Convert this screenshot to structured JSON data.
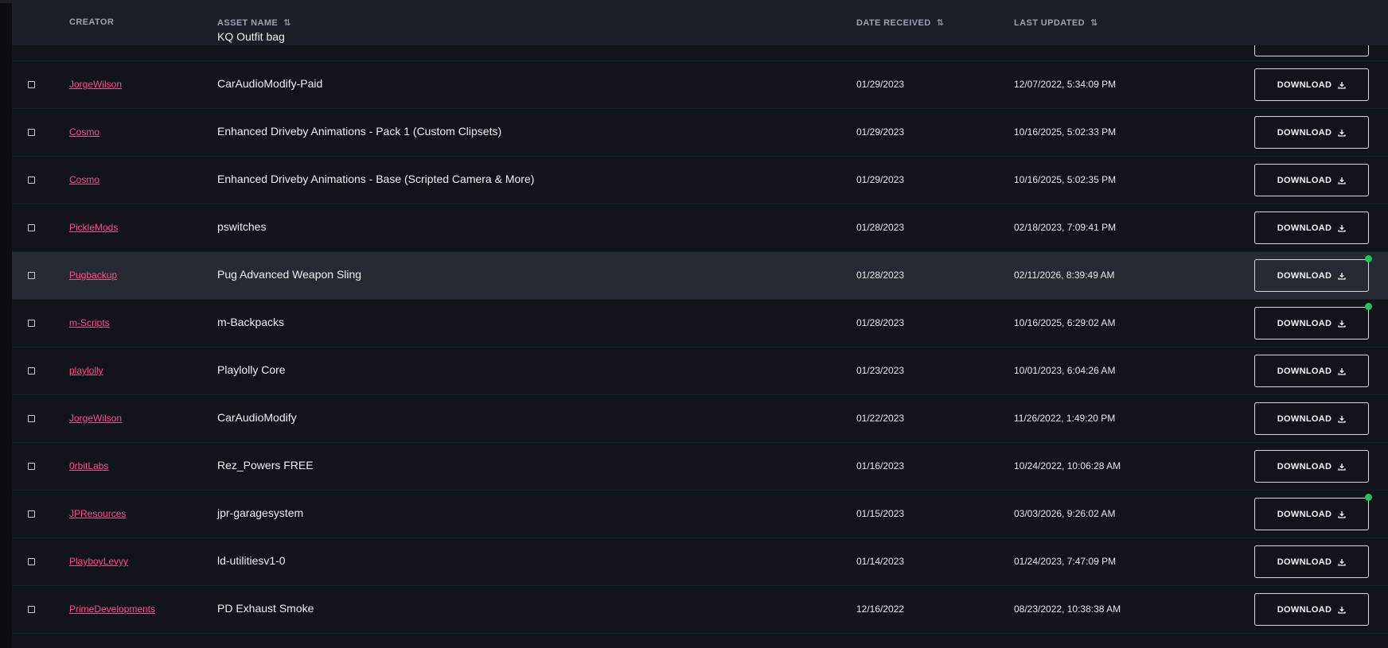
{
  "header": {
    "creator": "CREATOR",
    "asset_name": "ASSET NAME",
    "date_received": "DATE RECEIVED",
    "last_updated": "LAST UPDATED",
    "sort_icon": "⇅"
  },
  "peek_row": {
    "asset": "KQ Outfit bag"
  },
  "download_label": "DOWNLOAD",
  "colors": {
    "accent": "#ff4d8d",
    "new_badge": "#21c55d",
    "highlight_row": "#262a33"
  },
  "rows": [
    {
      "creator": "JorgeWilson",
      "asset": "CarAudioModify-Paid",
      "date": "01/29/2023",
      "updated": "12/07/2022, 5:34:09 PM",
      "dot": false,
      "highlight": false
    },
    {
      "creator": "Cosmo",
      "asset": "Enhanced Driveby Animations - Pack 1 (Custom Clipsets)",
      "date": "01/29/2023",
      "updated": "10/16/2025, 5:02:33 PM",
      "dot": false,
      "highlight": false
    },
    {
      "creator": "Cosmo",
      "asset": "Enhanced Driveby Animations - Base (Scripted Camera & More)",
      "date": "01/29/2023",
      "updated": "10/16/2025, 5:02:35 PM",
      "dot": false,
      "highlight": false
    },
    {
      "creator": "PickleMods",
      "asset": "pswitches",
      "date": "01/28/2023",
      "updated": "02/18/2023, 7:09:41 PM",
      "dot": false,
      "highlight": false
    },
    {
      "creator": "Pugbackup",
      "asset": "Pug Advanced Weapon Sling",
      "date": "01/28/2023",
      "updated": "02/11/2026, 8:39:49 AM",
      "dot": true,
      "highlight": true
    },
    {
      "creator": "m-Scripts",
      "asset": "m-Backpacks",
      "date": "01/28/2023",
      "updated": "10/16/2025, 6:29:02 AM",
      "dot": true,
      "highlight": false
    },
    {
      "creator": "playlolly",
      "asset": "Playlolly Core",
      "date": "01/23/2023",
      "updated": "10/01/2023, 6:04:26 AM",
      "dot": false,
      "highlight": false
    },
    {
      "creator": "JorgeWilson",
      "asset": "CarAudioModify",
      "date": "01/22/2023",
      "updated": "11/26/2022, 1:49:20 PM",
      "dot": false,
      "highlight": false
    },
    {
      "creator": "0rbitLabs",
      "asset": "Rez_Powers FREE",
      "date": "01/16/2023",
      "updated": "10/24/2022, 10:06:28 AM",
      "dot": false,
      "highlight": false
    },
    {
      "creator": "JPResources",
      "asset": "jpr-garagesystem",
      "date": "01/15/2023",
      "updated": "03/03/2026, 9:26:02 AM",
      "dot": true,
      "highlight": false
    },
    {
      "creator": "PlayboyLevyy",
      "asset": "ld-utilitiesv1-0",
      "date": "01/14/2023",
      "updated": "01/24/2023, 7:47:09 PM",
      "dot": false,
      "highlight": false
    },
    {
      "creator": "PrimeDevelopments",
      "asset": "PD Exhaust Smoke",
      "date": "12/16/2022",
      "updated": "08/23/2022, 10:38:38 AM",
      "dot": false,
      "highlight": false
    }
  ]
}
